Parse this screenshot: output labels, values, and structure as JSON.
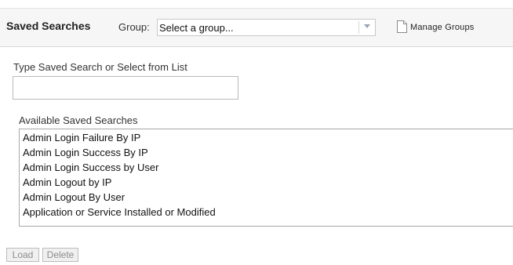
{
  "header": {
    "title": "Saved Searches",
    "group_label": "Group:",
    "group_select_value": "Select a group...",
    "manage_groups_label": "Manage Groups"
  },
  "search": {
    "label": "Type Saved Search or Select from List",
    "value": ""
  },
  "available": {
    "label": "Available Saved Searches",
    "items": [
      "Admin Login Failure By IP",
      "Admin Login Success By IP",
      "Admin Login Success by User",
      "Admin Logout by IP",
      "Admin Logout By User",
      "Application or Service Installed or Modified"
    ]
  },
  "buttons": {
    "load": "Load",
    "delete": "Delete"
  }
}
